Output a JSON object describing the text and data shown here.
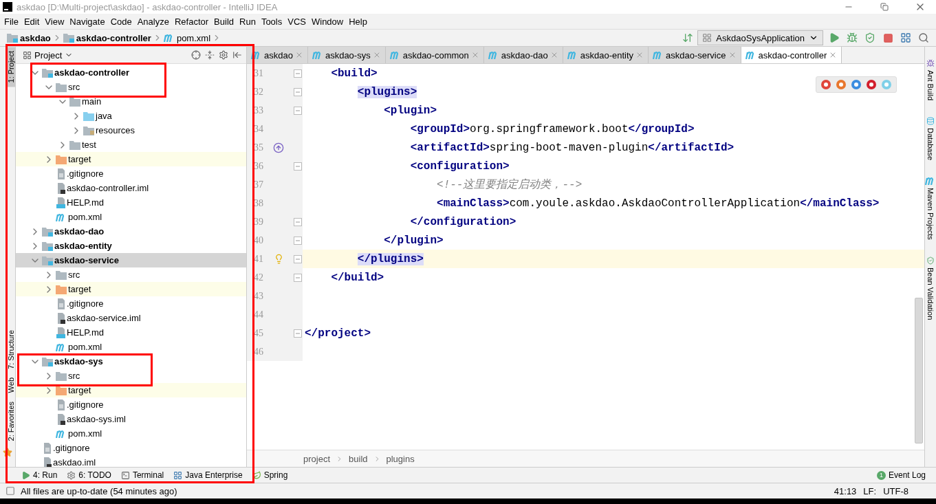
{
  "window": {
    "title": "askdao [D:\\Multi-project\\askdao] - askdao-controller - IntelliJ IDEA"
  },
  "menu": [
    "File",
    "Edit",
    "View",
    "Navigate",
    "Code",
    "Analyze",
    "Refactor",
    "Build",
    "Run",
    "Tools",
    "VCS",
    "Window",
    "Help"
  ],
  "breadcrumbs": [
    {
      "label": "askdao",
      "kind": "module"
    },
    {
      "label": "askdao-controller",
      "kind": "module"
    },
    {
      "label": "pom.xml",
      "kind": "maven"
    }
  ],
  "toolbar": {
    "run_configuration": "AskdaoSysApplication"
  },
  "left_stripe": [
    {
      "label": "1: Project",
      "selected": true
    },
    {
      "label": "7: Structure",
      "selected": false
    },
    {
      "label": "Web",
      "selected": false
    },
    {
      "label": "2: Favorites",
      "selected": false
    }
  ],
  "project_panel": {
    "title": "Project",
    "tree": [
      {
        "label": "askdao-controller",
        "kind": "module",
        "expanded": true,
        "selected": false,
        "children": [
          {
            "label": "src",
            "kind": "folder",
            "expanded": true,
            "selected": false,
            "children": [
              {
                "label": "main",
                "kind": "folder",
                "expanded": true,
                "selected": false,
                "children": [
                  {
                    "label": "java",
                    "kind": "source",
                    "expanded": false,
                    "selected": false
                  },
                  {
                    "label": "resources",
                    "kind": "resources",
                    "expanded": false,
                    "selected": false
                  }
                ]
              },
              {
                "label": "test",
                "kind": "folder",
                "expanded": false,
                "selected": false
              }
            ]
          },
          {
            "label": "target",
            "kind": "excluded",
            "expanded": false,
            "selected": false
          },
          {
            "label": ".gitignore",
            "kind": "text",
            "selected": false
          },
          {
            "label": "askdao-controller.iml",
            "kind": "iml",
            "selected": false
          },
          {
            "label": "HELP.md",
            "kind": "md",
            "selected": false
          },
          {
            "label": "pom.xml",
            "kind": "maven",
            "selected": false
          }
        ]
      },
      {
        "label": "askdao-dao",
        "kind": "module",
        "expanded": false,
        "selected": false
      },
      {
        "label": "askdao-entity",
        "kind": "module",
        "expanded": false,
        "selected": false
      },
      {
        "label": "askdao-service",
        "kind": "module",
        "expanded": true,
        "selected": true,
        "children": [
          {
            "label": "src",
            "kind": "folder",
            "expanded": false,
            "selected": false
          },
          {
            "label": "target",
            "kind": "excluded",
            "expanded": false,
            "selected": false
          },
          {
            "label": ".gitignore",
            "kind": "text",
            "selected": false
          },
          {
            "label": "askdao-service.iml",
            "kind": "iml",
            "selected": false
          },
          {
            "label": "HELP.md",
            "kind": "md",
            "selected": false
          },
          {
            "label": "pom.xml",
            "kind": "maven",
            "selected": false
          }
        ]
      },
      {
        "label": "askdao-sys",
        "kind": "module",
        "expanded": true,
        "selected": false,
        "children": [
          {
            "label": "src",
            "kind": "folder",
            "expanded": false,
            "selected": false
          },
          {
            "label": "target",
            "kind": "excluded",
            "expanded": false,
            "selected": false
          },
          {
            "label": ".gitignore",
            "kind": "text",
            "selected": false
          },
          {
            "label": "askdao-sys.iml",
            "kind": "iml",
            "selected": false
          },
          {
            "label": "pom.xml",
            "kind": "maven",
            "selected": false
          }
        ]
      },
      {
        "label": ".gitignore",
        "kind": "text",
        "selected": false
      },
      {
        "label": "askdao.iml",
        "kind": "iml",
        "selected": false
      }
    ]
  },
  "editor": {
    "tabs": [
      {
        "label": "askdao",
        "selected": false
      },
      {
        "label": "askdao-sys",
        "selected": false
      },
      {
        "label": "askdao-common",
        "selected": false
      },
      {
        "label": "askdao-dao",
        "selected": false
      },
      {
        "label": "askdao-entity",
        "selected": false
      },
      {
        "label": "askdao-service",
        "selected": false
      },
      {
        "label": "askdao-controller",
        "selected": true
      }
    ],
    "lines": [
      {
        "number": "31",
        "fold": true,
        "current": false,
        "segments": [
          {
            "kind": "tag",
            "text": "    <build>",
            "matched": false
          }
        ]
      },
      {
        "number": "32",
        "fold": true,
        "current": false,
        "segments": [
          {
            "kind": "tag",
            "text": "        <plugins>",
            "matched": true
          }
        ]
      },
      {
        "number": "33",
        "fold": true,
        "current": false,
        "segments": [
          {
            "kind": "tag",
            "text": "            <plugin>",
            "matched": false
          }
        ]
      },
      {
        "number": "34",
        "fold": false,
        "current": false,
        "segments": [
          {
            "kind": "tag",
            "text": "                <groupId>",
            "matched": false
          },
          {
            "kind": "text",
            "text": "org.springframework.boot",
            "matched": false
          },
          {
            "kind": "tag",
            "text": "</groupId>",
            "matched": false
          }
        ]
      },
      {
        "number": "35",
        "fold": false,
        "current": false,
        "kind": "override",
        "segments": [
          {
            "kind": "tag",
            "text": "                <artifactId>",
            "matched": false
          },
          {
            "kind": "text",
            "text": "spring-boot-maven-plugin",
            "matched": false
          },
          {
            "kind": "tag",
            "text": "</artifactId>",
            "matched": false
          }
        ]
      },
      {
        "number": "36",
        "fold": true,
        "current": false,
        "segments": [
          {
            "kind": "tag",
            "text": "                <configuration>",
            "matched": false
          }
        ]
      },
      {
        "number": "37",
        "fold": false,
        "current": false,
        "segments": [
          {
            "kind": "comment",
            "text": "                    <!--这里要指定启动类，-->",
            "matched": false
          }
        ]
      },
      {
        "number": "38",
        "fold": false,
        "current": false,
        "segments": [
          {
            "kind": "tag",
            "text": "                    <mainClass>",
            "matched": false
          },
          {
            "kind": "text",
            "text": "com.youle.askdao.AskdaoControllerApplication",
            "matched": false
          },
          {
            "kind": "tag",
            "text": "</mainClass>",
            "matched": false
          }
        ]
      },
      {
        "number": "39",
        "fold": true,
        "current": false,
        "segments": [
          {
            "kind": "tag",
            "text": "                </configuration>",
            "matched": false
          }
        ]
      },
      {
        "number": "40",
        "fold": true,
        "current": false,
        "segments": [
          {
            "kind": "tag",
            "text": "            </plugin>",
            "matched": false
          }
        ]
      },
      {
        "number": "41",
        "fold": true,
        "current": true,
        "kind": "bulb",
        "segments": [
          {
            "kind": "tag",
            "text": "        </plugins>",
            "matched": true
          }
        ]
      },
      {
        "number": "42",
        "fold": true,
        "current": false,
        "segments": [
          {
            "kind": "tag",
            "text": "    </build>",
            "matched": false
          }
        ]
      },
      {
        "number": "43",
        "fold": false,
        "current": false
      },
      {
        "number": "44",
        "fold": false,
        "current": false
      },
      {
        "number": "45",
        "fold": true,
        "current": false,
        "segments": [
          {
            "kind": "tag",
            "text": "</project>",
            "matched": false
          }
        ]
      },
      {
        "number": "46",
        "fold": false,
        "current": false
      }
    ],
    "path": [
      "project",
      "build",
      "plugins"
    ]
  },
  "right_stripe": [
    {
      "label": "Ant Build",
      "kind": "ant"
    },
    {
      "label": "Database",
      "kind": "database"
    },
    {
      "label": "Maven Projects",
      "kind": "maven"
    },
    {
      "label": "Bean Validation",
      "kind": "bean"
    }
  ],
  "tool_windows": [
    {
      "label": "4: Run",
      "kind": "run"
    },
    {
      "label": "6: TODO",
      "kind": "todo"
    },
    {
      "label": "Terminal",
      "kind": "terminal"
    },
    {
      "label": "Java Enterprise",
      "kind": "enterprise"
    },
    {
      "label": "Spring",
      "kind": "spring"
    }
  ],
  "event_log": {
    "label": "Event Log",
    "count": "1"
  },
  "status_bar": {
    "message": "All files are up-to-date (54 minutes ago)",
    "position": "41:13",
    "line_separator": "LF:",
    "encoding": "UTF-8"
  }
}
